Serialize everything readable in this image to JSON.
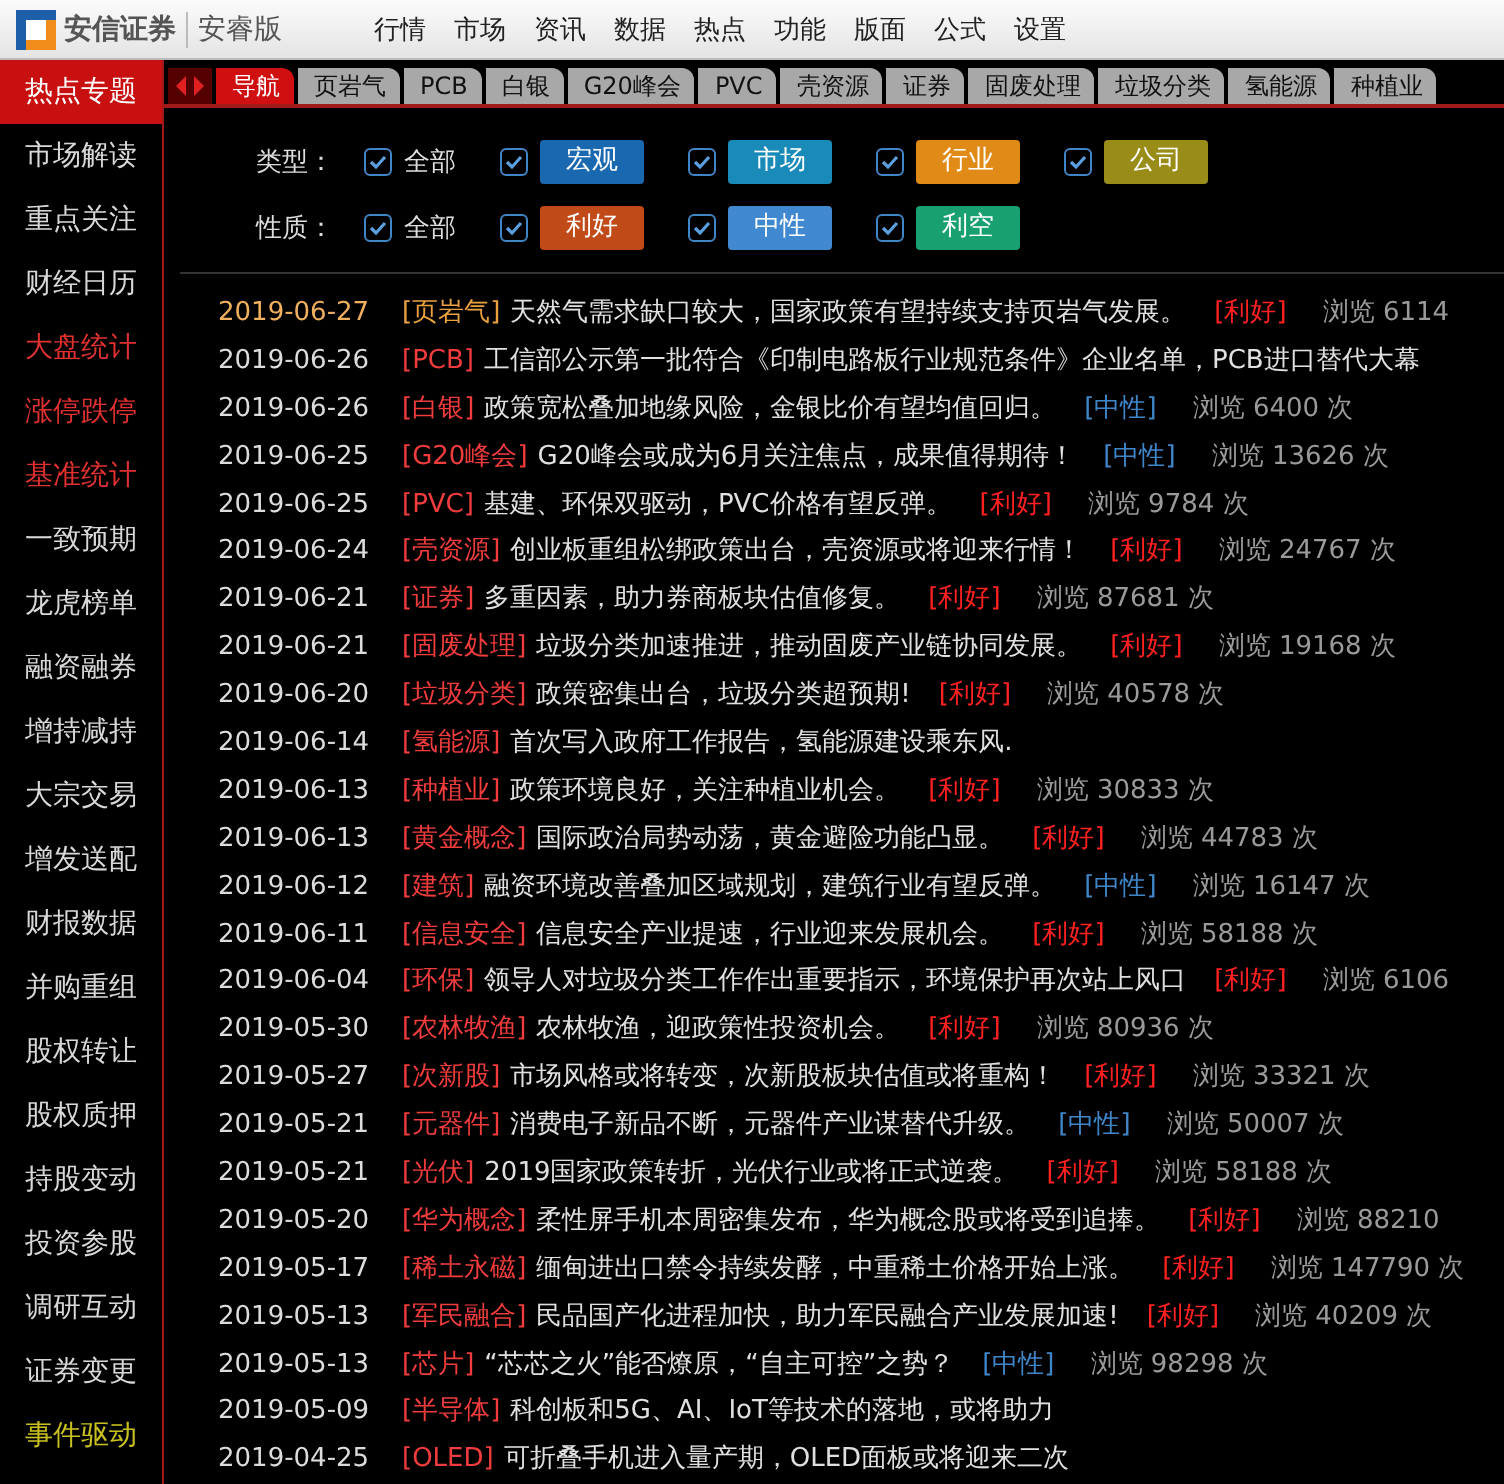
{
  "app": {
    "brand": "安信证券",
    "edition": "安睿版"
  },
  "menu": [
    "行情",
    "市场",
    "资讯",
    "数据",
    "热点",
    "功能",
    "版面",
    "公式",
    "设置"
  ],
  "sidebar": {
    "items": [
      {
        "label": "热点专题",
        "selected": true
      },
      {
        "label": "市场解读",
        "selected": false
      },
      {
        "label": "重点关注",
        "selected": false
      },
      {
        "label": "财经日历",
        "selected": false
      },
      {
        "label": "大盘统计",
        "selected": false,
        "color": "#e03030"
      },
      {
        "label": "涨停跌停",
        "selected": false,
        "color": "#e03030"
      },
      {
        "label": "基准统计",
        "selected": false,
        "color": "#e03030"
      },
      {
        "label": "一致预期",
        "selected": false
      },
      {
        "label": "龙虎榜单",
        "selected": false
      },
      {
        "label": "融资融券",
        "selected": false
      },
      {
        "label": "增持减持",
        "selected": false
      },
      {
        "label": "大宗交易",
        "selected": false
      },
      {
        "label": "增发送配",
        "selected": false
      },
      {
        "label": "财报数据",
        "selected": false
      },
      {
        "label": "并购重组",
        "selected": false
      },
      {
        "label": "股权转让",
        "selected": false
      },
      {
        "label": "股权质押",
        "selected": false
      },
      {
        "label": "持股变动",
        "selected": false
      },
      {
        "label": "投资参股",
        "selected": false
      },
      {
        "label": "调研互动",
        "selected": false
      },
      {
        "label": "证券变更",
        "selected": false
      },
      {
        "label": "事件驱动",
        "selected": false,
        "color": "#c8c020"
      }
    ]
  },
  "tabs": [
    {
      "label": "导航",
      "selected": true
    },
    {
      "label": "页岩气",
      "selected": false
    },
    {
      "label": "PCB",
      "selected": false
    },
    {
      "label": "白银",
      "selected": false
    },
    {
      "label": "G20峰会",
      "selected": false
    },
    {
      "label": "PVC",
      "selected": false
    },
    {
      "label": "壳资源",
      "selected": false
    },
    {
      "label": "证券",
      "selected": false
    },
    {
      "label": "固废处理",
      "selected": false
    },
    {
      "label": "垃圾分类",
      "selected": false
    },
    {
      "label": "氢能源",
      "selected": false
    },
    {
      "label": "种植业",
      "selected": false
    }
  ],
  "filters": [
    {
      "label": "类型：",
      "options": [
        {
          "label": "全部",
          "checked": true
        },
        {
          "label": "宏观",
          "checked": true,
          "color": "#1a68b0"
        },
        {
          "label": "市场",
          "checked": true,
          "color": "#1a8ab8"
        },
        {
          "label": "行业",
          "checked": true,
          "color": "#e08a18"
        },
        {
          "label": "公司",
          "checked": true,
          "color": "#9a8c18"
        }
      ]
    },
    {
      "label": "性质：",
      "options": [
        {
          "label": "全部",
          "checked": true
        },
        {
          "label": "利好",
          "checked": true,
          "color": "#c04a18"
        },
        {
          "label": "中性",
          "checked": true,
          "color": "#4088d0"
        },
        {
          "label": "利空",
          "checked": true,
          "color": "#18a070"
        }
      ]
    }
  ],
  "news": [
    {
      "date": "2019-06-27",
      "topic": "[页岩气]",
      "text": "天然气需求缺口较大，国家政策有望持续支持页岩气发展。",
      "tag": "[利好]",
      "kind": "positive",
      "views": "浏览 6114",
      "highlighted": true
    },
    {
      "date": "2019-06-26",
      "topic": "[PCB]",
      "text": "工信部公示第一批符合《印制电路板行业规范条件》企业名单，PCB进口替代大幕",
      "highlighted": false
    },
    {
      "date": "2019-06-26",
      "topic": "[白银]",
      "text": "政策宽松叠加地缘风险，金银比价有望均值回归。",
      "tag": "[中性]",
      "kind": "neutral",
      "views": "浏览 6400 次",
      "highlighted": false
    },
    {
      "date": "2019-06-25",
      "topic": "[G20峰会]",
      "text": "G20峰会或成为6月关注焦点，成果值得期待！",
      "tag": "[中性]",
      "kind": "neutral",
      "views": "浏览 13626 次",
      "highlighted": false
    },
    {
      "date": "2019-06-25",
      "topic": "[PVC]",
      "text": "基建、环保双驱动，PVC价格有望反弹。",
      "tag": "[利好]",
      "kind": "positive",
      "views": "浏览 9784 次",
      "highlighted": false
    },
    {
      "date": "2019-06-24",
      "topic": "[壳资源]",
      "text": "创业板重组松绑政策出台，壳资源或将迎来行情！",
      "tag": "[利好]",
      "kind": "positive",
      "views": "浏览 24767 次",
      "highlighted": false
    },
    {
      "date": "2019-06-21",
      "topic": "[证券]",
      "text": "多重因素，助力券商板块估值修复。",
      "tag": "[利好]",
      "kind": "positive",
      "views": "浏览 87681 次",
      "highlighted": false
    },
    {
      "date": "2019-06-21",
      "topic": "[固废处理]",
      "text": "垃圾分类加速推进，推动固废产业链协同发展。",
      "tag": "[利好]",
      "kind": "positive",
      "views": "浏览 19168 次",
      "highlighted": false
    },
    {
      "date": "2019-06-20",
      "topic": "[垃圾分类]",
      "text": "政策密集出台，垃圾分类超预期!",
      "tag": "[利好]",
      "kind": "positive",
      "views": "浏览 40578 次",
      "highlighted": false
    },
    {
      "date": "2019-06-14",
      "topic": "[氢能源]",
      "text": "首次写入政府工作报告，氢能源建设乘东风.",
      "highlighted": false
    },
    {
      "date": "2019-06-13",
      "topic": "[种植业]",
      "text": "政策环境良好，关注种植业机会。",
      "tag": "[利好]",
      "kind": "positive",
      "views": "浏览 30833 次",
      "highlighted": false
    },
    {
      "date": "2019-06-13",
      "topic": "[黄金概念]",
      "text": "国际政治局势动荡，黄金避险功能凸显。",
      "tag": "[利好]",
      "kind": "positive",
      "views": "浏览 44783 次",
      "highlighted": false
    },
    {
      "date": "2019-06-12",
      "topic": "[建筑]",
      "text": "融资环境改善叠加区域规划，建筑行业有望反弹。",
      "tag": "[中性]",
      "kind": "neutral",
      "views": "浏览 16147 次",
      "highlighted": false
    },
    {
      "date": "2019-06-11",
      "topic": "[信息安全]",
      "text": "信息安全产业提速，行业迎来发展机会。",
      "tag": "[利好]",
      "kind": "positive",
      "views": "浏览 58188 次",
      "highlighted": false
    },
    {
      "date": "2019-06-04",
      "topic": "[环保]",
      "text": "领导人对垃圾分类工作作出重要指示，环境保护再次站上风口",
      "tag": "[利好]",
      "kind": "positive",
      "views": "浏览 6106",
      "highlighted": false
    },
    {
      "date": "2019-05-30",
      "topic": "[农林牧渔]",
      "text": "农林牧渔，迎政策性投资机会。",
      "tag": "[利好]",
      "kind": "positive",
      "views": "浏览 80936 次",
      "highlighted": false
    },
    {
      "date": "2019-05-27",
      "topic": "[次新股]",
      "text": "市场风格或将转变，次新股板块估值或将重构！",
      "tag": "[利好]",
      "kind": "positive",
      "views": "浏览 33321 次",
      "highlighted": false
    },
    {
      "date": "2019-05-21",
      "topic": "[元器件]",
      "text": "消费电子新品不断，元器件产业谋替代升级。",
      "tag": "[中性]",
      "kind": "neutral",
      "views": "浏览 50007 次",
      "highlighted": false
    },
    {
      "date": "2019-05-21",
      "topic": "[光伏]",
      "text": "2019国家政策转折，光伏行业或将正式逆袭。",
      "tag": "[利好]",
      "kind": "positive",
      "views": "浏览 58188 次",
      "highlighted": false
    },
    {
      "date": "2019-05-20",
      "topic": "[华为概念]",
      "text": "柔性屏手机本周密集发布，华为概念股或将受到追捧。",
      "tag": "[利好]",
      "kind": "positive",
      "views": "浏览 88210",
      "highlighted": false
    },
    {
      "date": "2019-05-17",
      "topic": "[稀土永磁]",
      "text": "缅甸进出口禁令持续发酵，中重稀土价格开始上涨。",
      "tag": "[利好]",
      "kind": "positive",
      "views": "浏览 147790 次",
      "highlighted": false
    },
    {
      "date": "2019-05-13",
      "topic": "[军民融合]",
      "text": "民品国产化进程加快，助力军民融合产业发展加速!",
      "tag": "[利好]",
      "kind": "positive",
      "views": "浏览 40209 次",
      "highlighted": false
    },
    {
      "date": "2019-05-13",
      "topic": "[芯片]",
      "text": "“芯芯之火”能否燎原，“自主可控”之势？",
      "tag": "[中性]",
      "kind": "neutral",
      "views": "浏览 98298 次",
      "highlighted": false
    },
    {
      "date": "2019-05-09",
      "topic": "[半导体]",
      "text": "科创板和5G、AI、IoT等技术的落地，或将助力",
      "highlighted": false
    },
    {
      "date": "2019-04-25",
      "topic": "[OLED]",
      "text": "可折叠手机进入量产期，OLED面板或将迎来二次",
      "highlighted": false
    }
  ]
}
